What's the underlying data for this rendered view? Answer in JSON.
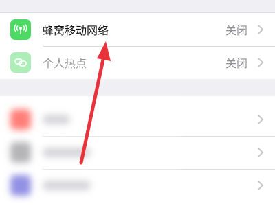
{
  "settings": {
    "rows": [
      {
        "label": "蜂窝移动网络",
        "value": "关闭",
        "icon": "cellular-antenna-icon",
        "icon_color": "#4cd964"
      },
      {
        "label": "个人热点",
        "value": "关闭",
        "icon": "hotspot-link-icon",
        "icon_color": "#4cd964"
      }
    ],
    "blurred_rows": [
      {
        "icon_color": "#ff3b30"
      },
      {
        "icon_color": "#8e8e93"
      },
      {
        "icon_color": "#5856d6"
      }
    ]
  },
  "annotation": {
    "arrow_color": "#e8333d"
  }
}
